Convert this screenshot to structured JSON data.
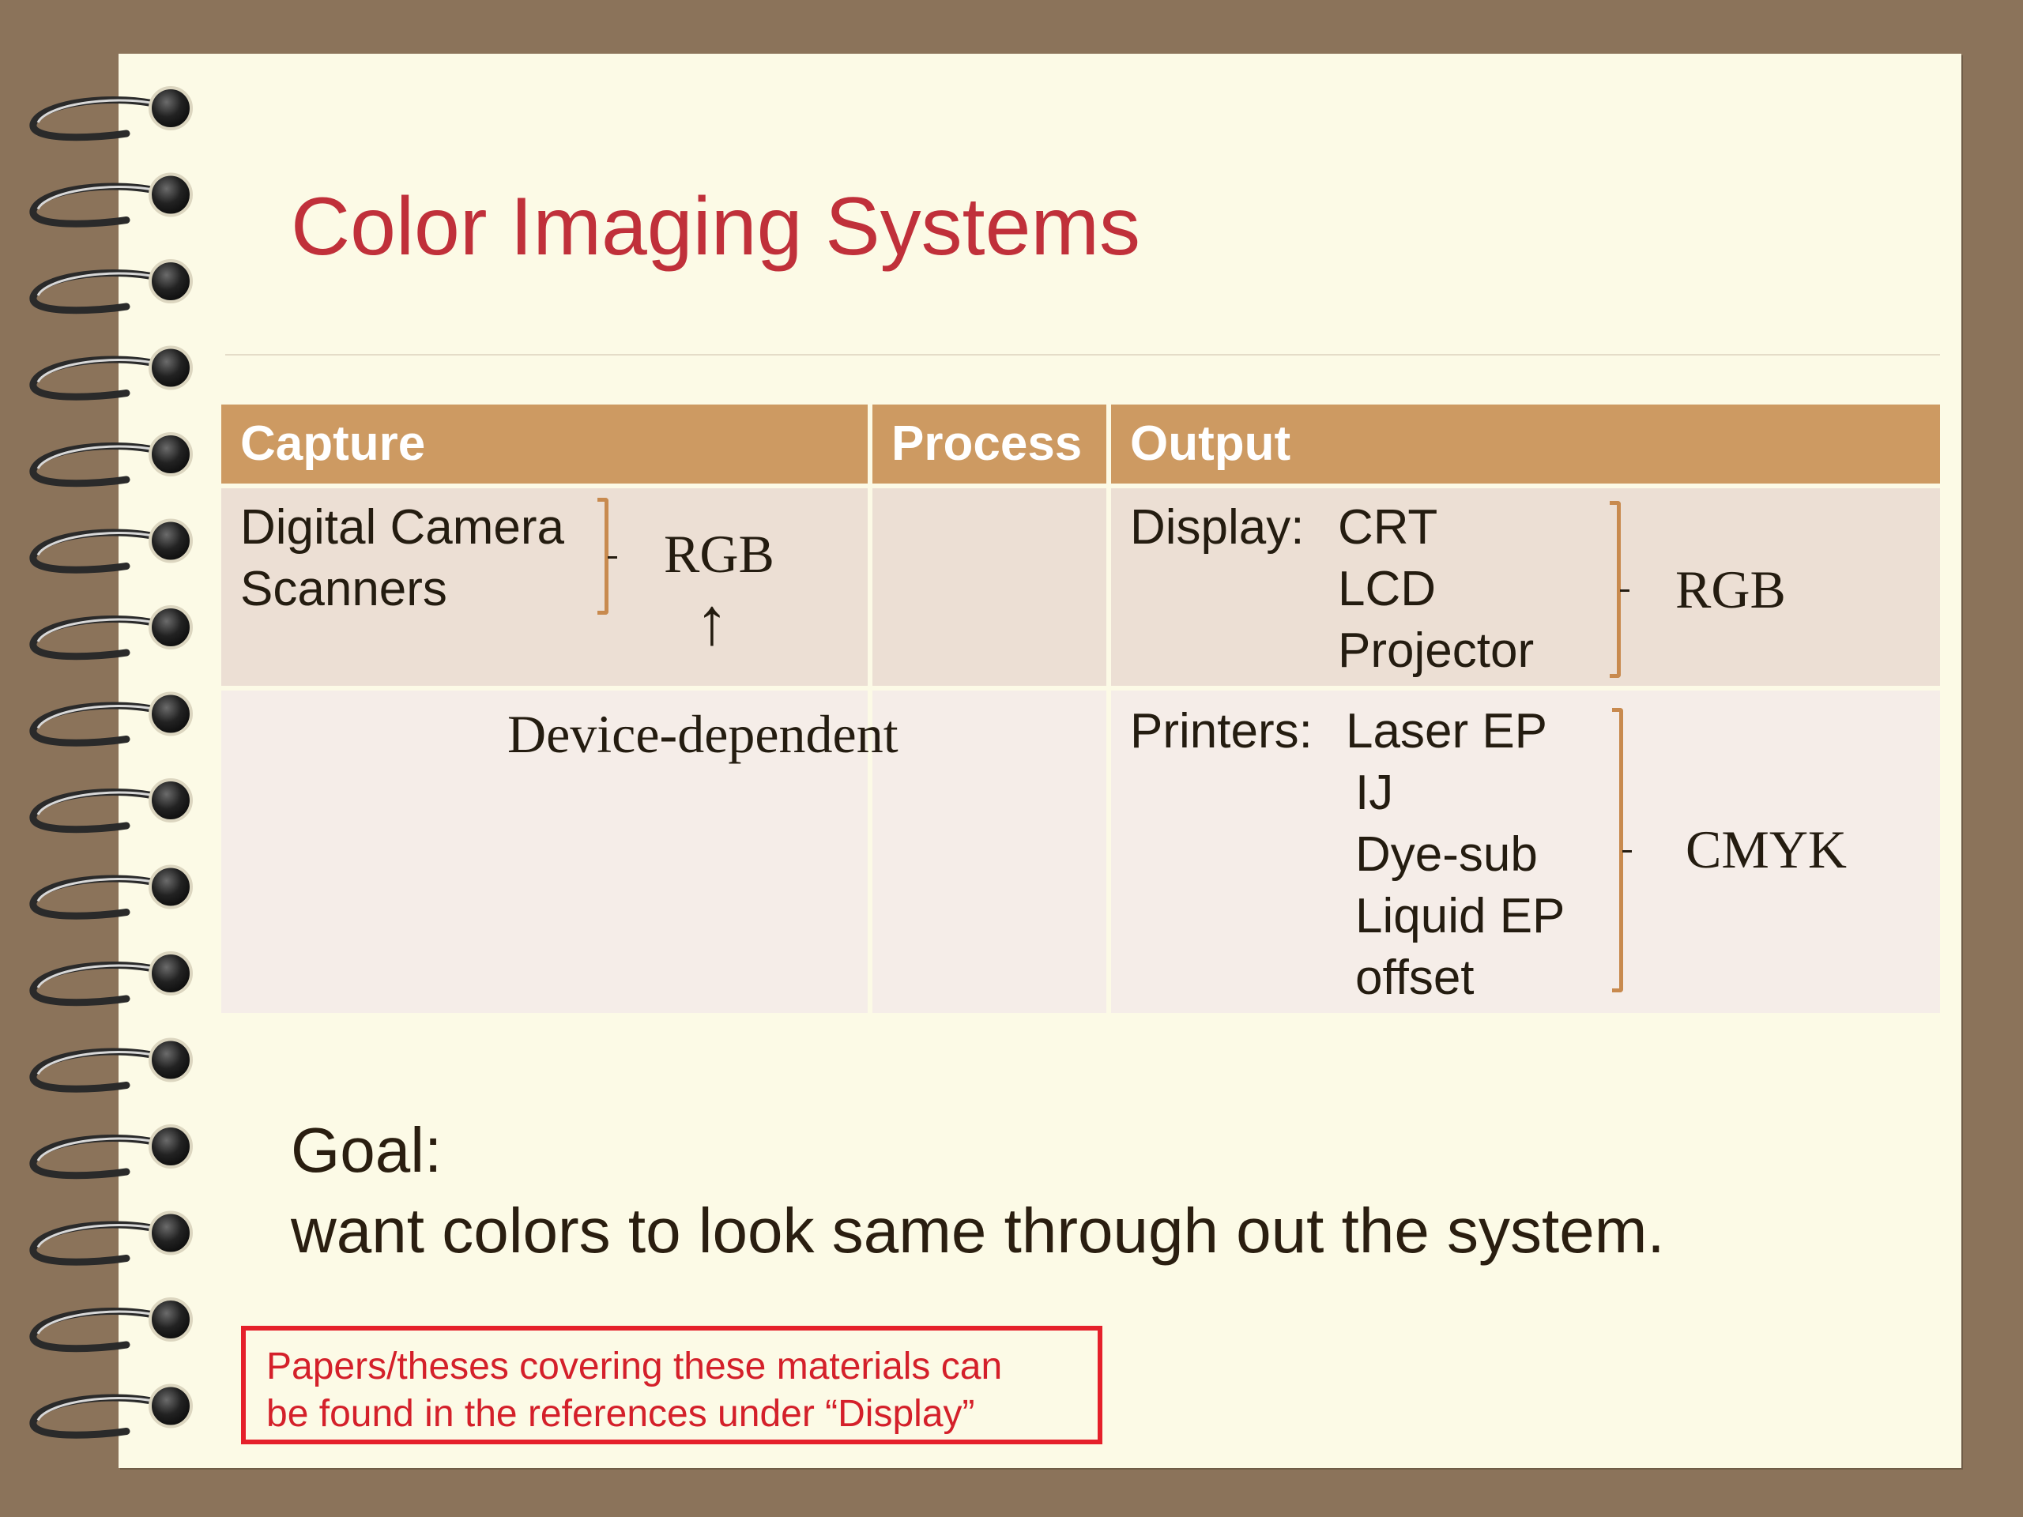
{
  "slide": {
    "title": "Color Imaging Systems"
  },
  "table": {
    "headers": {
      "capture": "Capture",
      "process": "Process",
      "output": "Output"
    },
    "capture": {
      "devices": [
        "Digital Camera",
        "Scanners"
      ],
      "color_space": "RGB",
      "arrow": "↑",
      "annotation": "Device-dependent"
    },
    "output": {
      "display": {
        "label": "Display:",
        "devices": [
          "CRT",
          "LCD",
          "Projector"
        ],
        "color_space": "RGB"
      },
      "printers": {
        "label": "Printers:",
        "devices": [
          "Laser EP",
          "IJ",
          "Dye-sub",
          "Liquid EP",
          "offset"
        ],
        "color_space": "CMYK"
      }
    }
  },
  "goal": {
    "label": "Goal:",
    "text": "want colors to look same through out the system."
  },
  "note": {
    "line1": "Papers/theses covering these materials can",
    "line2": "be found in the references under “Display”"
  },
  "colors": {
    "background": "#8b735a",
    "paper": "#fcfae6",
    "title": "#c0303a",
    "header": "#cd9a62",
    "row1": "#ecdfd4",
    "row2": "#f5ede8",
    "bracket": "#c88a4e",
    "note_border": "#e5202a"
  }
}
